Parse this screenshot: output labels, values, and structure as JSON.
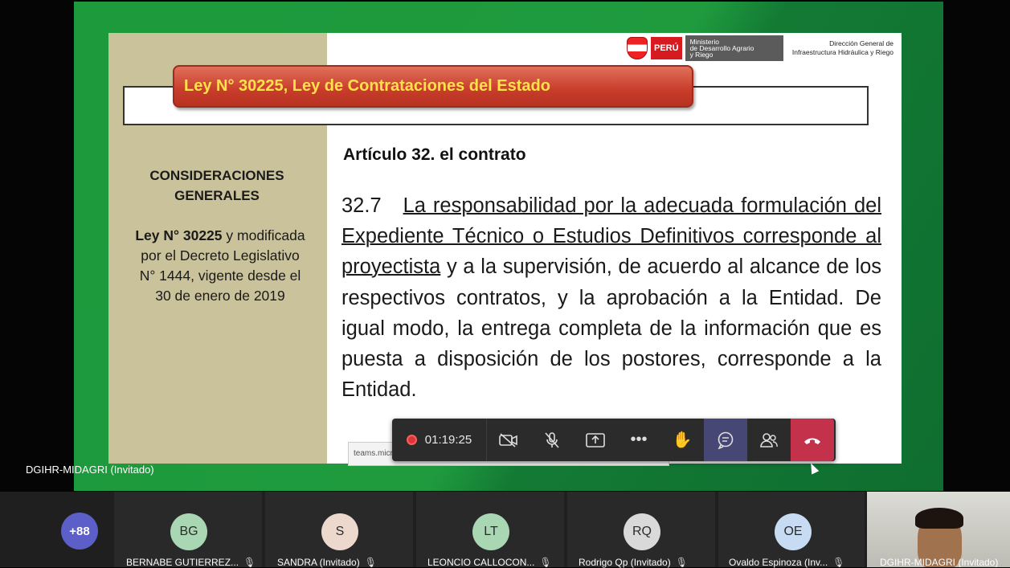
{
  "slide": {
    "logo": {
      "country": "PERÚ",
      "ministry_lines": [
        "Ministerio",
        "de Desarrollo Agrario",
        "y Riego"
      ]
    },
    "direction_lines": [
      "Dirección General de",
      "Infraestructura  Hidráulica y Riego"
    ],
    "title": "Ley N° 30225, Ley de Contrataciones del Estado",
    "left_heading_lines": [
      "CONSIDERACIONES",
      "GENERALES"
    ],
    "left_desc": {
      "ley": "Ley N°  30225",
      "rest_1": " y modificada",
      "line2": "por el Decreto Legislativo",
      "line3": "N°  1444, vigente desde el",
      "line4": "30 de enero de 2019"
    },
    "article_title": "Artículo 32. el contrato",
    "article_number": "32.7",
    "article_underlined": "La responsabilidad por la adecuada formulación del Expediente Técnico o Estudios Definitivos corresponde al proyectista",
    "article_rest": "y a la supervisión, de acuerdo al alcance de los respectivos contratos, y la aprobación a la Entidad. De igual modo, la entrega completa de la información que es puesta a disposición de los postores, corresponde a la Entidad."
  },
  "share": {
    "link_bar_text": "teams.microsoft.com está compartiendo tu pantalla",
    "presenter_label": "DGIHR-MIDAGRI (Invitado)"
  },
  "toolbar": {
    "timer": "01:19:25",
    "icons": [
      "camera-off-icon",
      "mic-off-icon",
      "share-screen-icon",
      "more-icon",
      "raise-hand-icon",
      "chat-icon",
      "participants-icon",
      "hang-up-icon"
    ]
  },
  "participants": {
    "overflow": "+88",
    "tiles": [
      {
        "initials": "BG",
        "name": "BERNABE GUTIERREZ...",
        "color": "#a9d7b3"
      },
      {
        "initials": "S",
        "name": "SANDRA (Invitado)",
        "color": "#ecd8cc"
      },
      {
        "initials": "LT",
        "name": "LEONCIO CALLOCON...",
        "color": "#a9d7b3"
      },
      {
        "initials": "RQ",
        "name": "Rodrigo Qp (Invitado)",
        "color": "#d9d9d9"
      },
      {
        "initials": "OE",
        "name": "Ovaldo Espinoza (Inv...",
        "color": "#c7dcf2"
      }
    ],
    "video_name": "DGIHR-MIDAGRI (Invitado)"
  }
}
